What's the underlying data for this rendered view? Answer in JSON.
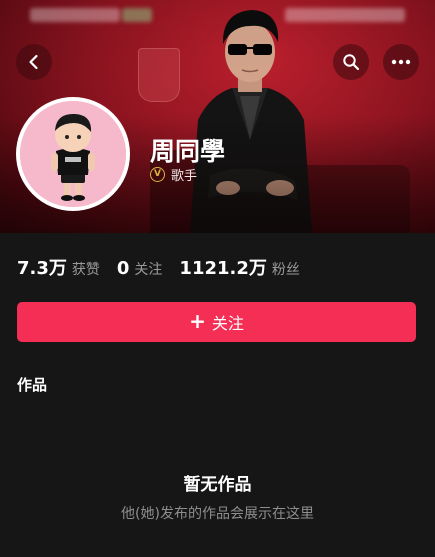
{
  "header": {
    "back_icon": "chevron-left-icon",
    "search_icon": "search-icon",
    "more_icon": "more-horizontal-icon"
  },
  "profile": {
    "name": "周同學",
    "verified_badge": "V",
    "role": "歌手"
  },
  "stats": [
    {
      "value": "7.3万",
      "label": "获赞"
    },
    {
      "value": "0",
      "label": "关注"
    },
    {
      "value": "1121.2万",
      "label": "粉丝"
    }
  ],
  "follow_button": {
    "icon": "+",
    "label": "关注"
  },
  "works": {
    "title": "作品",
    "empty_title": "暂无作品",
    "empty_desc": "他(她)发布的作品会展示在这里"
  },
  "colors": {
    "accent": "#f42e55",
    "background": "#161616",
    "banner_red": "#c0202e",
    "verify_gold": "#e0b43c"
  }
}
